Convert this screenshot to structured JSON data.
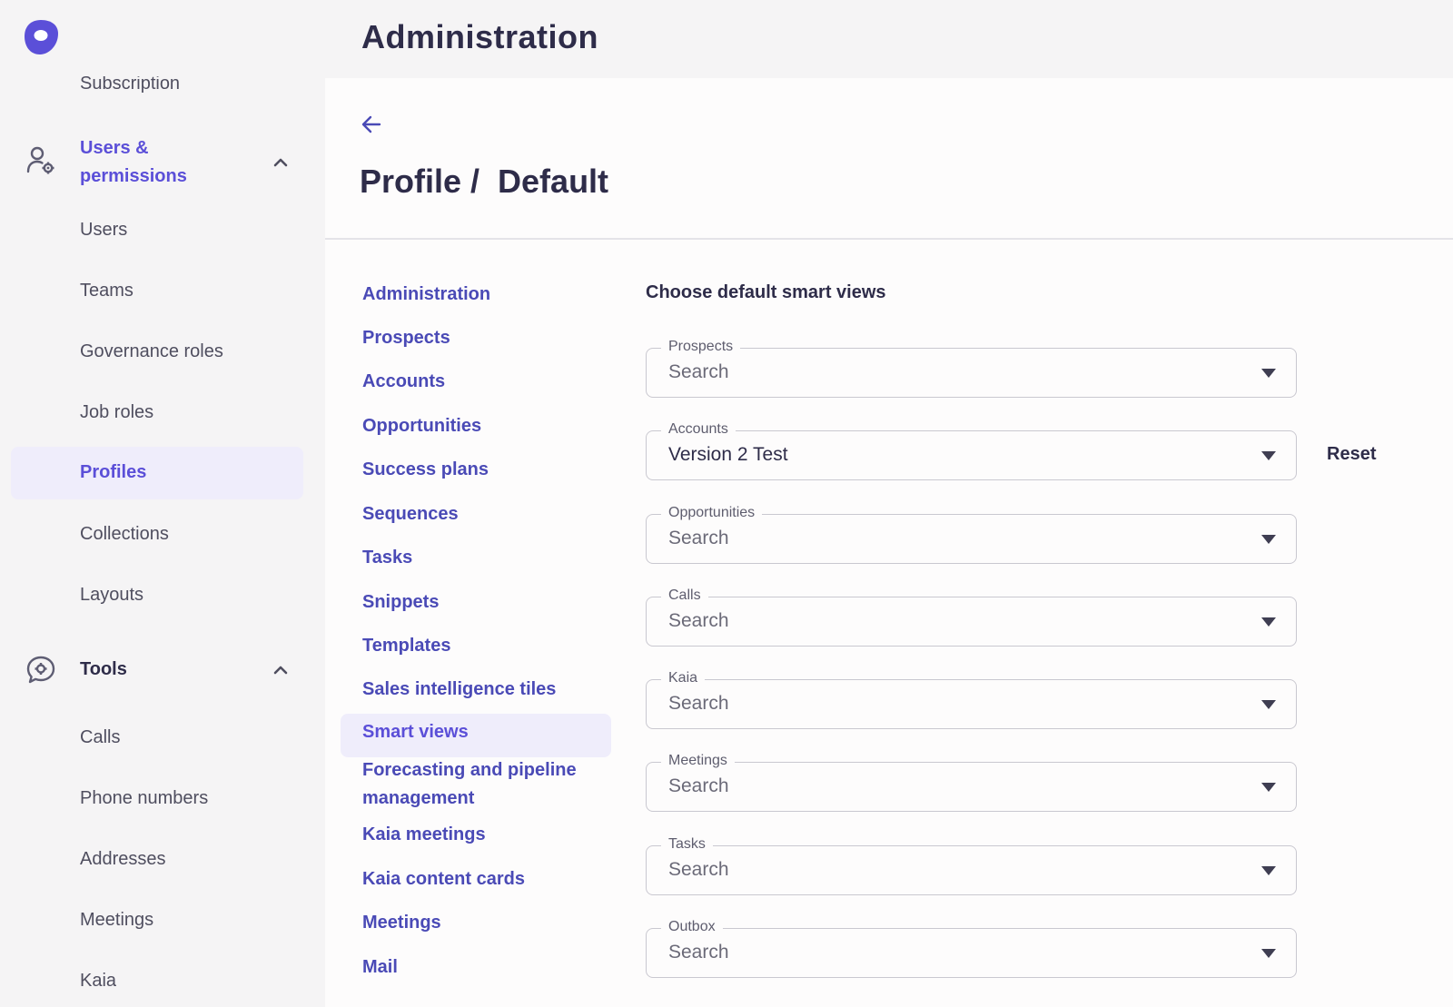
{
  "header": {
    "title": "Administration"
  },
  "sidebar": {
    "cut_item": "Subscription",
    "groups": [
      {
        "label": "Users & permissions",
        "label_line1": "Users &",
        "label_line2": "permissions",
        "icon": "user-gear-icon",
        "items": [
          "Users",
          "Teams",
          "Governance roles",
          "Job roles",
          "Profiles",
          "Collections",
          "Layouts"
        ],
        "active": "Profiles"
      },
      {
        "label": "Tools",
        "icon": "chat-gear-icon",
        "items": [
          "Calls",
          "Phone numbers",
          "Addresses",
          "Meetings",
          "Kaia"
        ]
      }
    ]
  },
  "page": {
    "title": "Profile /  Default",
    "back": "back-arrow-icon"
  },
  "subnav": {
    "items": [
      "Administration",
      "Prospects",
      "Accounts",
      "Opportunities",
      "Success plans",
      "Sequences",
      "Tasks",
      "Snippets",
      "Templates",
      "Sales intelligence tiles",
      "Smart views",
      "Forecasting and pipeline",
      "management",
      "Kaia meetings",
      "Kaia content cards",
      "Meetings",
      "Mail"
    ],
    "active": "Smart views"
  },
  "smart_views": {
    "title": "Choose default smart views",
    "reset_label": "Reset",
    "fields": [
      {
        "label": "Prospects",
        "value": "Search",
        "filled": false
      },
      {
        "label": "Accounts",
        "value": "Version 2 Test",
        "filled": true
      },
      {
        "label": "Opportunities",
        "value": "Search",
        "filled": false
      },
      {
        "label": "Calls",
        "value": "Search",
        "filled": false
      },
      {
        "label": "Kaia",
        "value": "Search",
        "filled": false
      },
      {
        "label": "Meetings",
        "value": "Search",
        "filled": false
      },
      {
        "label": "Tasks",
        "value": "Search",
        "filled": false
      },
      {
        "label": "Outbox",
        "value": "Search",
        "filled": false
      }
    ]
  },
  "colors": {
    "accent": "#5b4fd8",
    "nav_link": "#4a4ab6",
    "text": "#2e2c49",
    "active_bg": "#efedfb"
  }
}
